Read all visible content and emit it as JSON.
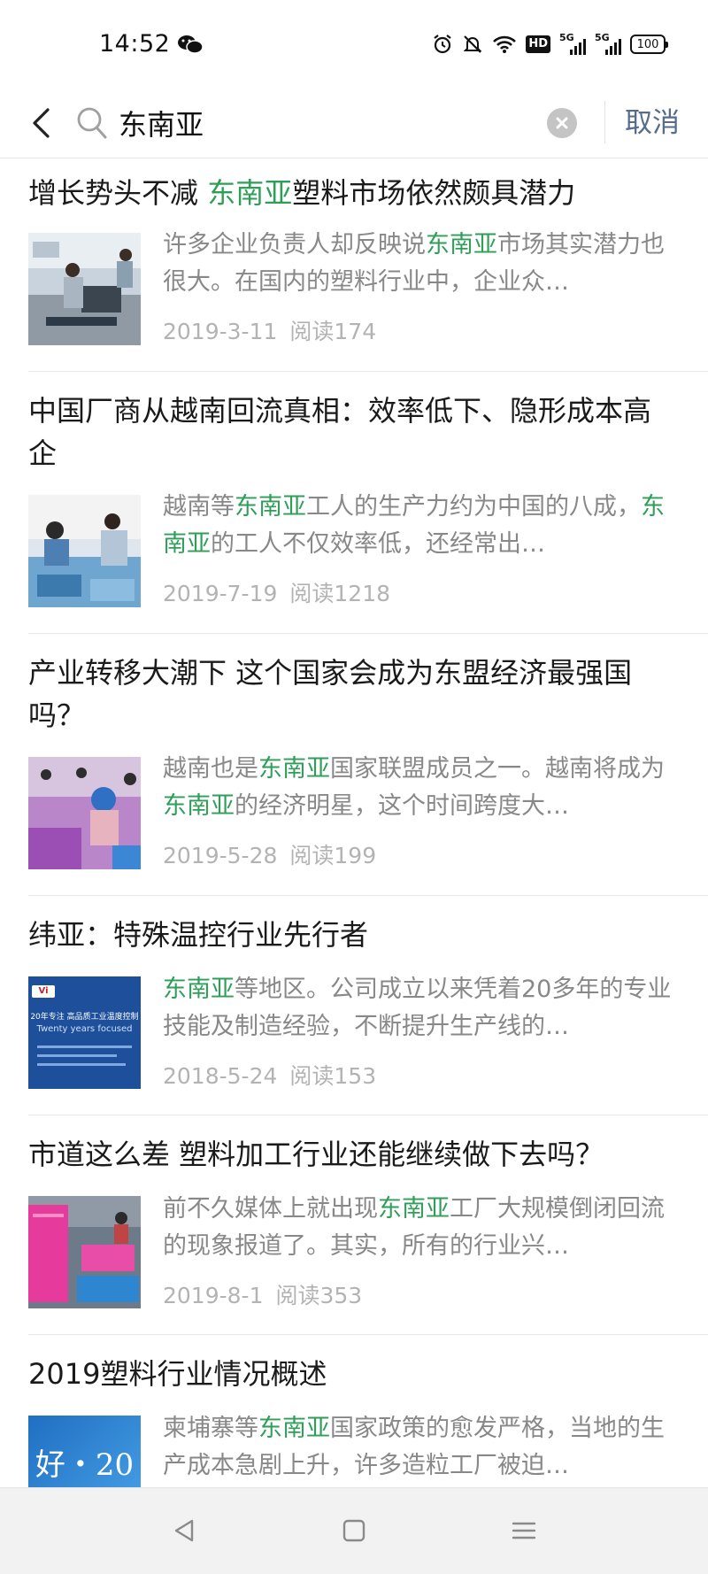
{
  "status_bar": {
    "time": "14:52",
    "icons": [
      "wechat-icon",
      "alarm-icon",
      "mute-icon",
      "wifi-icon",
      "hd-icon",
      "signal-5g-icon",
      "signal-5g-icon",
      "battery-icon"
    ],
    "hd_label": "HD",
    "net1": "5G",
    "net2": "5G",
    "battery": "100"
  },
  "search": {
    "query": "东南亚",
    "cancel_label": "取消"
  },
  "colors": {
    "highlight": "#2e9e58",
    "cancel": "#566c8c"
  },
  "results": [
    {
      "title": "增长势头不减 东南亚塑料市场依然颇具潜力",
      "title_parts": [
        "增长势头不减 ",
        "东南亚",
        "塑料市场依然颇具潜力"
      ],
      "snippet_parts": [
        "许多企业负责人却反映说",
        "东南亚",
        "市场其实潜力也很大。在国内的塑料行业中，企业众…"
      ],
      "date": "2019-3-11",
      "reads": "阅读174",
      "thumb": "factory-workers-image"
    },
    {
      "title": "中国厂商从越南回流真相：效率低下、隐形成本高企",
      "snippet_parts": [
        "越南等",
        "东南亚",
        "工人的生产力约为中国的八成，",
        "东南亚",
        "的工人不仅效率低，还经常出…"
      ],
      "date": "2019-7-19",
      "reads": "阅读1218",
      "thumb": "garment-workers-image"
    },
    {
      "title": "产业转移大潮下 这个国家会成为东盟经济最强国吗？",
      "snippet_parts": [
        "越南也是",
        "东南亚",
        "国家联盟成员之一。越南将成为",
        "东南亚",
        "的经济明星，这个时间跨度大…"
      ],
      "date": "2019-5-28",
      "reads": "阅读199",
      "thumb": "sewing-workers-image"
    },
    {
      "title": "纬亚：特殊温控行业先行者",
      "snippet_parts": [
        "东南亚",
        "等地区。公司成立以来凭着20多年的专业技能及制造经验，不断提升生产线的…"
      ],
      "date": "2018-5-24",
      "reads": "阅读153",
      "thumb": "company-banner-image",
      "thumb_text": "20年专注 高品质工业温度控制",
      "thumb_sub": "Twenty years focused",
      "thumb_logo": "Vi"
    },
    {
      "title": "市道这么差 塑料加工行业还能继续做下去吗？",
      "snippet_parts": [
        "前不久媒体上就出现",
        "东南亚",
        "工厂大规模倒闭回流的现象报道了。其实，所有的行业兴…"
      ],
      "date": "2019-8-1",
      "reads": "阅读353",
      "thumb": "plastic-products-image"
    },
    {
      "title": "2019塑料行业情况概述",
      "snippet_parts": [
        "柬埔寨等",
        "东南亚",
        "国家政策的愈发严格，当地的生产成本急剧上升，许多造粒工厂被迫…"
      ],
      "thumb": "new-year-banner-image",
      "thumb_text": "好・20"
    }
  ],
  "nav": [
    "back-nav-icon",
    "home-nav-icon",
    "menu-nav-icon"
  ]
}
